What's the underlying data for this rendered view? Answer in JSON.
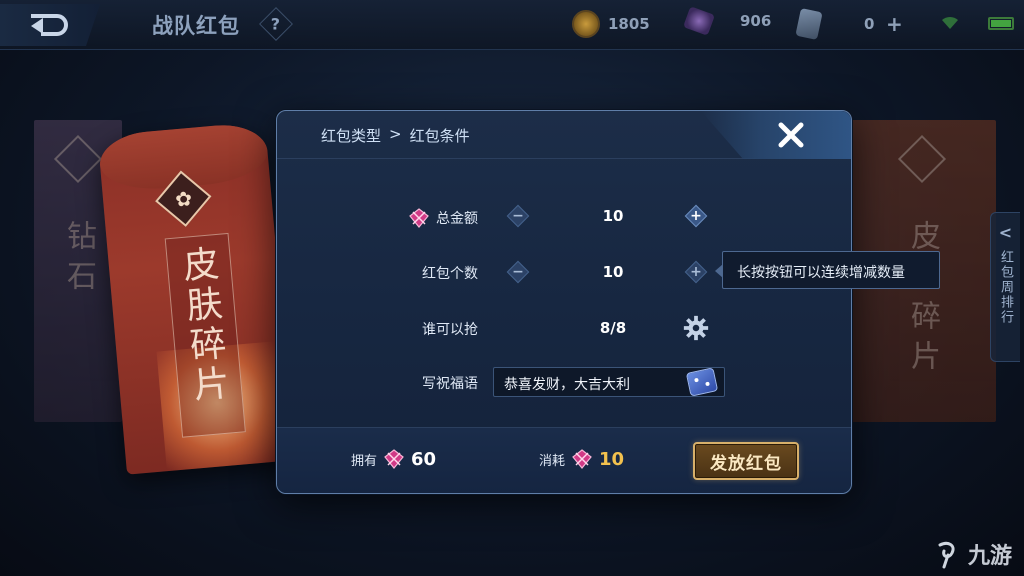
{
  "topbar": {
    "title": "战队红包",
    "help_label": "?",
    "currencies": [
      {
        "name": "gold",
        "value": "1805"
      },
      {
        "name": "diamond",
        "value": "906"
      },
      {
        "name": "coupon",
        "value": "0"
      }
    ],
    "plus_label": "+"
  },
  "background": {
    "left_card_text": "钻石",
    "envelope_text": "皮肤碎片",
    "right_card_text": "皮肤碎片"
  },
  "side_tab": {
    "chevron": "<",
    "label": "红包周排行"
  },
  "modal": {
    "breadcrumb": {
      "step1": "红包类型",
      "separator": ">",
      "step2": "红包条件"
    },
    "rows": {
      "total_amount": {
        "label": "总金额",
        "value": "10"
      },
      "count": {
        "label": "红包个数",
        "value": "10"
      },
      "who_can_grab": {
        "label": "谁可以抢",
        "value": "8/8"
      },
      "blessing": {
        "label": "写祝福语",
        "value": "恭喜发财，大吉大利"
      }
    },
    "stepper": {
      "minus": "−",
      "plus": "+"
    },
    "footer": {
      "owned_label": "拥有",
      "owned_value": "60",
      "cost_label": "消耗",
      "cost_value": "10",
      "send_label": "发放红包"
    }
  },
  "tooltip": {
    "text": "长按按钮可以连续增减数量"
  },
  "watermark": {
    "text": "九游"
  },
  "colors": {
    "accent_gold": "#d8b06a",
    "cost_gold": "#f2c14e",
    "panel_bg": "#172741",
    "panel_border": "#5f7ea8"
  }
}
